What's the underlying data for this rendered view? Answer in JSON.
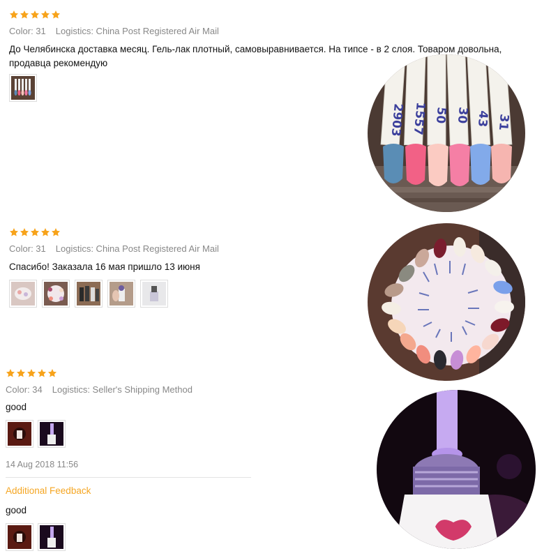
{
  "reviews": [
    {
      "rating": 5,
      "color": "Color: 31",
      "logistics": "Logistics: China Post Registered Air Mail",
      "text": "До Челябинска доставка месяц. Гель-лак плотный, самовыравнивается. На типсе - в 2 слоя. Товаром довольна, продавца рекомендую",
      "photo_count": 1,
      "photo_labels": [
        "2903",
        "1557",
        "50",
        "30",
        "43",
        "31"
      ]
    },
    {
      "rating": 5,
      "color": "Color: 31",
      "logistics": "Logistics: China Post Registered Air Mail",
      "text": "Спасибо! Заказала 16 мая пришло 13 июня",
      "photo_count": 5
    },
    {
      "rating": 5,
      "color": "Color: 34",
      "logistics": "Logistics: Seller's Shipping Method",
      "text": "good",
      "photo_count": 2,
      "date": "14 Aug 2018 11:56",
      "additional_label": "Additional Feedback",
      "additional_text": "good",
      "additional_photo_count": 2
    }
  ],
  "colors": {
    "star": "#f7a31b",
    "meta": "#888888",
    "accent": "#f5a623"
  }
}
